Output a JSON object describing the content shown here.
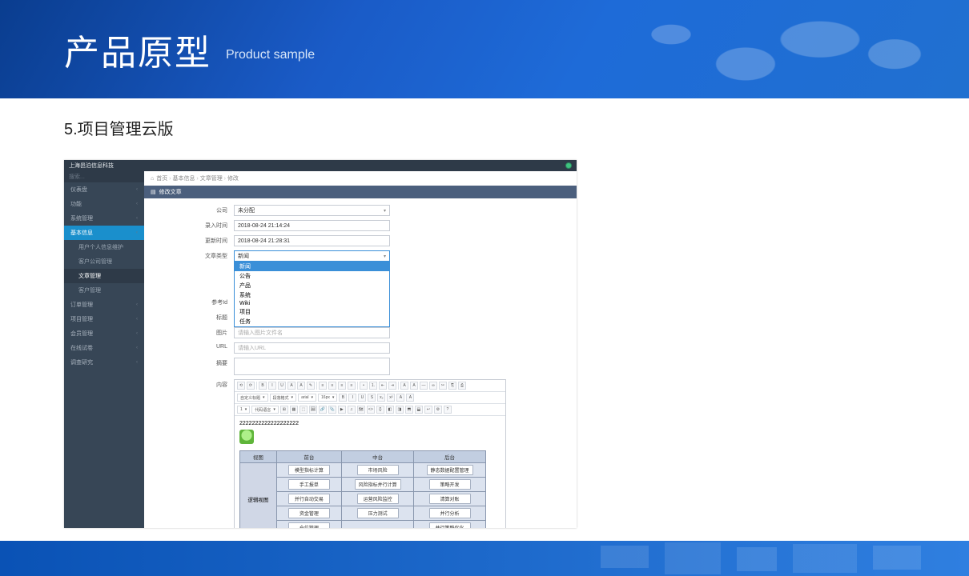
{
  "banner": {
    "title_zh": "产品原型",
    "title_en": "Product sample"
  },
  "section": {
    "title": "5.项目管理云版"
  },
  "app": {
    "brand": "上海邑泊信息科技",
    "search_placeholder": "搜索..."
  },
  "sidebar": {
    "items": [
      {
        "label": "仪表盘",
        "icon": "dashboard"
      },
      {
        "label": "功能",
        "icon": "fn"
      },
      {
        "label": "系统管理",
        "icon": "gear"
      },
      {
        "label": "基本信息",
        "icon": "info",
        "active": true
      },
      {
        "label": "用户个人信息维护",
        "level": 2
      },
      {
        "label": "客户公司管理",
        "level": 2
      },
      {
        "label": "文章管理",
        "level": 2,
        "on": true
      },
      {
        "label": "客户管理",
        "level": 2
      },
      {
        "label": "订单管理",
        "icon": "order"
      },
      {
        "label": "项目管理",
        "icon": "proj"
      },
      {
        "label": "会员管理",
        "icon": "member"
      },
      {
        "label": "在线试卷",
        "icon": "exam"
      },
      {
        "label": "调查研究",
        "icon": "survey"
      }
    ]
  },
  "breadcrumb": {
    "home_icon": "home",
    "parts": [
      "首页",
      "基本信息",
      "文章管理",
      "修改"
    ],
    "sep": "›"
  },
  "panel": {
    "icon": "doc",
    "title": "修改文章"
  },
  "form": {
    "company_label": "公司",
    "company_value": "未分配",
    "entry_time_label": "录入时间",
    "entry_time_value": "2018-08-24 21:14:24",
    "update_time_label": "更新时间",
    "update_time_value": "2018-08-24 21:28:31",
    "type_label": "文章类型",
    "type_options": [
      "新闻",
      "公告",
      "产品",
      "系统",
      "Wiki",
      "项目",
      "任务"
    ],
    "type_selected": "新闻",
    "ref_label": "参考Id",
    "title_label": "标题",
    "image_label": "图片",
    "image_placeholder": "请输入图片文件名",
    "url_label": "URL",
    "url_placeholder": "请输入URL",
    "summary_label": "摘要",
    "content_label": "内容"
  },
  "editor": {
    "selects": [
      "自定义标题",
      "段落格式",
      "arial",
      "16px",
      "1",
      "代码语言"
    ],
    "content_text": "2222222222222222222"
  },
  "inner_table": {
    "headers": [
      "视图",
      "前台",
      "中台",
      "后台"
    ],
    "row_header": "逻辑视图",
    "cells": {
      "front": [
        "模型指标计算",
        "手工报单",
        "并行自动交易",
        "资金管理",
        "仓位管理"
      ],
      "middle": [
        "市场风险",
        "风险指标并行计算",
        "运营风险监控",
        "压力测试"
      ],
      "back": [
        "静态数据配置管理",
        "策略开发",
        "清算对账",
        "并行分析",
        "并行策略优化"
      ]
    }
  }
}
